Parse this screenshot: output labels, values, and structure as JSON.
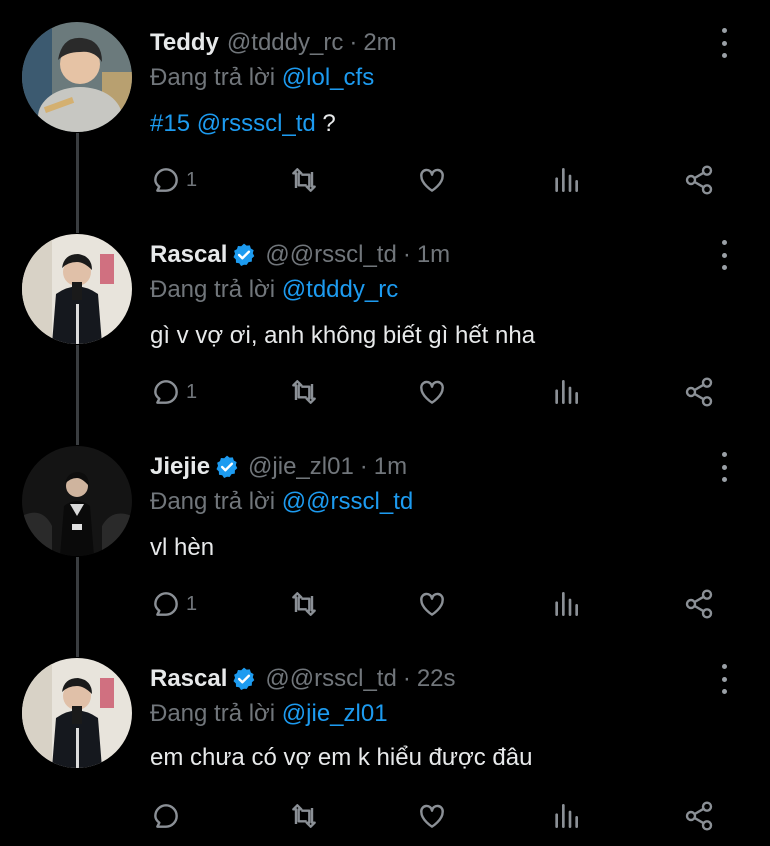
{
  "tweets": [
    {
      "name": "Teddy",
      "verified": false,
      "handle": "@tdddy_rc",
      "time": "2m",
      "reply_prefix": "Đang trả lời",
      "reply_to": "@lol_cfs",
      "text_link": "#15 @rssscl_td",
      "text": " ?",
      "reply_count": "1"
    },
    {
      "name": "Rascal",
      "verified": true,
      "handle": "@@rsscl_td",
      "time": "1m",
      "reply_prefix": "Đang trả lời",
      "reply_to": "@tdddy_rc",
      "text_link": "",
      "text": "gì v vợ ơi, anh không biết gì hết nha",
      "reply_count": "1"
    },
    {
      "name": "Jiejie",
      "verified": true,
      "handle": "@jie_zl01",
      "time": "1m",
      "reply_prefix": "Đang trả lời",
      "reply_to": "@@rsscl_td",
      "text_link": "",
      "text": "vl hèn",
      "reply_count": "1"
    },
    {
      "name": "Rascal",
      "verified": true,
      "handle": "@@rsscl_td",
      "time": "22s",
      "reply_prefix": "Đang trả lời",
      "reply_to": "@jie_zl01",
      "text_link": "",
      "text": "em chưa có vợ em k hiểu được đâu",
      "reply_count": ""
    }
  ],
  "separator": "·",
  "icons": [
    "reply-icon",
    "retweet-icon",
    "like-icon",
    "analytics-icon",
    "share-icon",
    "more-icon",
    "verified-badge-icon"
  ],
  "colors": {
    "background": "#000000",
    "link": "#1d9bf0",
    "muted": "#71767b",
    "text": "#e7e9ea",
    "verified": "#1d9bf0"
  }
}
